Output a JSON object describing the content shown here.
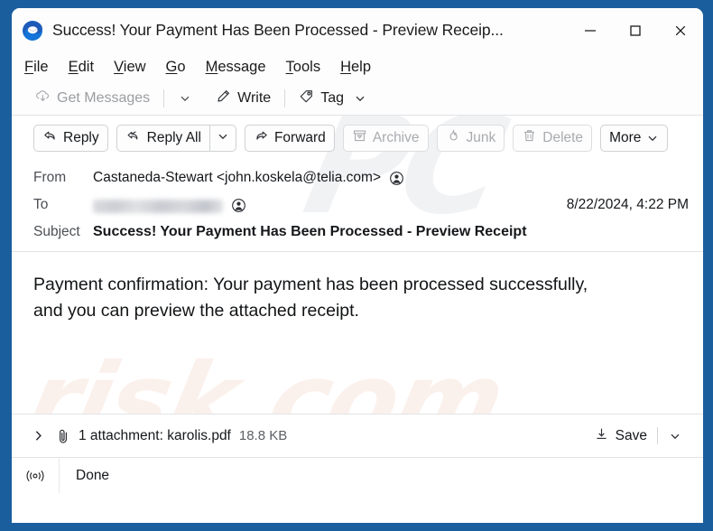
{
  "window": {
    "title": "Success! Your Payment Has Been Processed - Preview Receip...",
    "logo_icon": "thunderbird-logo-icon",
    "minimize_label": "Minimize",
    "maximize_label": "Maximize",
    "close_label": "Close",
    "frame_color": "#1b5e9e"
  },
  "watermarks": {
    "top": "PC",
    "bottom": "risk.com"
  },
  "menubar": {
    "items": [
      {
        "label": "File",
        "accesskey": "F"
      },
      {
        "label": "Edit",
        "accesskey": "E"
      },
      {
        "label": "View",
        "accesskey": "V"
      },
      {
        "label": "Go",
        "accesskey": "G"
      },
      {
        "label": "Message",
        "accesskey": "M"
      },
      {
        "label": "Tools",
        "accesskey": "T"
      },
      {
        "label": "Help",
        "accesskey": "H"
      }
    ]
  },
  "maintoolbar": {
    "get_messages": "Get Messages",
    "get_messages_icon": "download-cloud-icon",
    "get_messages_disabled": true,
    "get_messages_chevron_icon": "chevron-down-icon",
    "write": "Write",
    "write_icon": "pencil-icon",
    "tag": "Tag",
    "tag_icon": "tag-icon",
    "tag_chevron_icon": "chevron-down-icon"
  },
  "msgtoolbar": {
    "reply": "Reply",
    "reply_icon": "reply-arrow-icon",
    "reply_all": "Reply All",
    "reply_all_icon": "reply-all-arrow-icon",
    "reply_all_chevron_icon": "chevron-down-icon",
    "forward": "Forward",
    "forward_icon": "forward-arrow-icon",
    "archive": "Archive",
    "archive_icon": "archive-box-icon",
    "archive_disabled": true,
    "junk": "Junk",
    "junk_icon": "junk-flame-icon",
    "junk_disabled": true,
    "delete": "Delete",
    "delete_icon": "trash-icon",
    "delete_disabled": true,
    "more": "More",
    "more_chevron_icon": "chevron-down-icon"
  },
  "headers": {
    "from_label": "From",
    "from_value": "Castaneda-Stewart <john.koskela@telia.com>",
    "from_contact_icon": "contact-avatar-icon",
    "to_label": "To",
    "to_value": "",
    "to_redacted": true,
    "to_contact_icon": "contact-avatar-icon",
    "subject_label": "Subject",
    "subject_value": "Success! Your Payment Has Been Processed - Preview Receipt",
    "date": "8/22/2024, 4:22 PM"
  },
  "body": {
    "text": "Payment confirmation: Your payment has been processed successfully, and you can preview the attached receipt."
  },
  "attachment": {
    "expander_icon": "chevron-right-icon",
    "clip_icon": "paperclip-icon",
    "label": "1 attachment: karolis.pdf",
    "size": "18.8 KB",
    "save_label": "Save",
    "save_icon": "download-icon",
    "save_chevron_icon": "chevron-down-icon"
  },
  "statusbar": {
    "icon": "online-broadcast-icon",
    "text": "Done"
  }
}
